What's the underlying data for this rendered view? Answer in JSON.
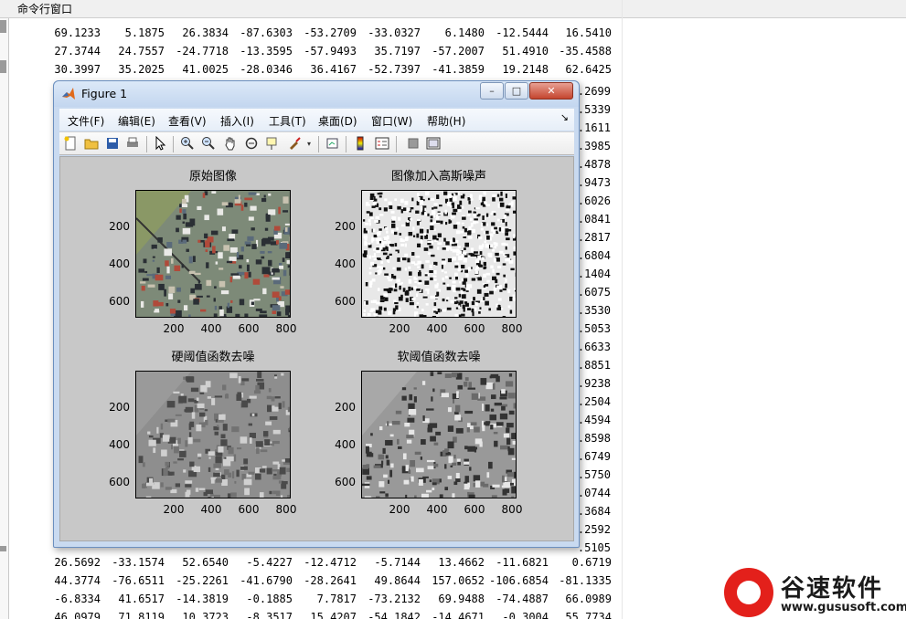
{
  "command_window": {
    "title": "命令行窗口",
    "rows_top": [
      [
        "69.1233",
        "5.1875",
        "26.3834",
        "-87.6303",
        "-53.2709",
        "-33.0327",
        "6.1480",
        "-12.5444",
        "16.5410"
      ],
      [
        "27.3744",
        "24.7557",
        "-24.7718",
        "-13.3595",
        "-57.9493",
        "35.7197",
        "-57.2007",
        "51.4910",
        "-35.4588"
      ],
      [
        "30.3997",
        "35.2025",
        "41.0025",
        "-28.0346",
        "36.4167",
        "-52.7397",
        "-41.3859",
        "19.2148",
        "62.6425"
      ]
    ],
    "right_fragments": [
      ".2699",
      ".5339",
      ".1611",
      ".3985",
      ".4878",
      ".9473",
      ".6026",
      ".0841",
      ".2817",
      ".6804",
      ".1404",
      ".6075",
      ".3530",
      ".5053",
      ".6633",
      ".8851",
      ".9238",
      ".2504",
      ".4594",
      ".8598",
      ".6749",
      ".5750",
      ".0744",
      ".3684",
      ".2592",
      ".5105"
    ],
    "rows_bottom": [
      [
        "26.5692",
        "-33.1574",
        "52.6540",
        "-5.4227",
        "-12.4712",
        "-5.7144",
        "13.4662",
        "-11.6821",
        "0.6719"
      ],
      [
        "44.3774",
        "-76.6511",
        "-25.2261",
        "-41.6790",
        "-28.2641",
        "49.8644",
        "157.0652",
        "-106.6854",
        "-81.1335"
      ],
      [
        "-6.8334",
        "41.6517",
        "-14.3819",
        "-0.1885",
        "7.7817",
        "-73.2132",
        "69.9488",
        "-74.4887",
        "66.0989"
      ],
      [
        "46.0979",
        "71.8119",
        "10.3723",
        "-8.3517",
        "15.4207",
        "-54.1842",
        "-14.4671",
        "-0.3004",
        "55.7734"
      ]
    ]
  },
  "figure": {
    "title": "Figure 1",
    "window_buttons": {
      "minimize": "–",
      "maximize": "□",
      "close": "✕"
    },
    "menu": [
      "文件(F)",
      "编辑(E)",
      "查看(V)",
      "插入(I)",
      "工具(T)",
      "桌面(D)",
      "窗口(W)",
      "帮助(H)"
    ],
    "dock_arrow": "↘",
    "toolbar_icons": [
      "new-file-icon",
      "open-folder-icon",
      "save-icon",
      "print-icon",
      "pointer-icon",
      "zoom-in-icon",
      "zoom-out-icon",
      "pan-hand-icon",
      "rotate-3d-icon",
      "data-cursor-icon",
      "brush-icon",
      "link-plot-icon",
      "colorbar-icon",
      "legend-icon",
      "hide-plot-tools-icon",
      "show-plot-tools-icon"
    ],
    "subplots": [
      {
        "title": "原始图像",
        "style": "color",
        "yticks": [
          "200",
          "400",
          "600"
        ],
        "xticks": [
          "200",
          "400",
          "600",
          "800"
        ]
      },
      {
        "title": "图像加入高斯噪声",
        "style": "noise",
        "yticks": [
          "200",
          "400",
          "600"
        ],
        "xticks": [
          "200",
          "400",
          "600",
          "800"
        ]
      },
      {
        "title": "硬阈值函数去噪",
        "style": "gray",
        "yticks": [
          "200",
          "400",
          "600"
        ],
        "xticks": [
          "200",
          "400",
          "600",
          "800"
        ]
      },
      {
        "title": "软阈值函数去噪",
        "style": "gray2",
        "yticks": [
          "200",
          "400",
          "600"
        ],
        "xticks": [
          "200",
          "400",
          "600",
          "800"
        ]
      }
    ]
  },
  "watermark": {
    "brand": "谷速软件",
    "url": "www.gususoft.com",
    "accent": "#e3201b"
  }
}
